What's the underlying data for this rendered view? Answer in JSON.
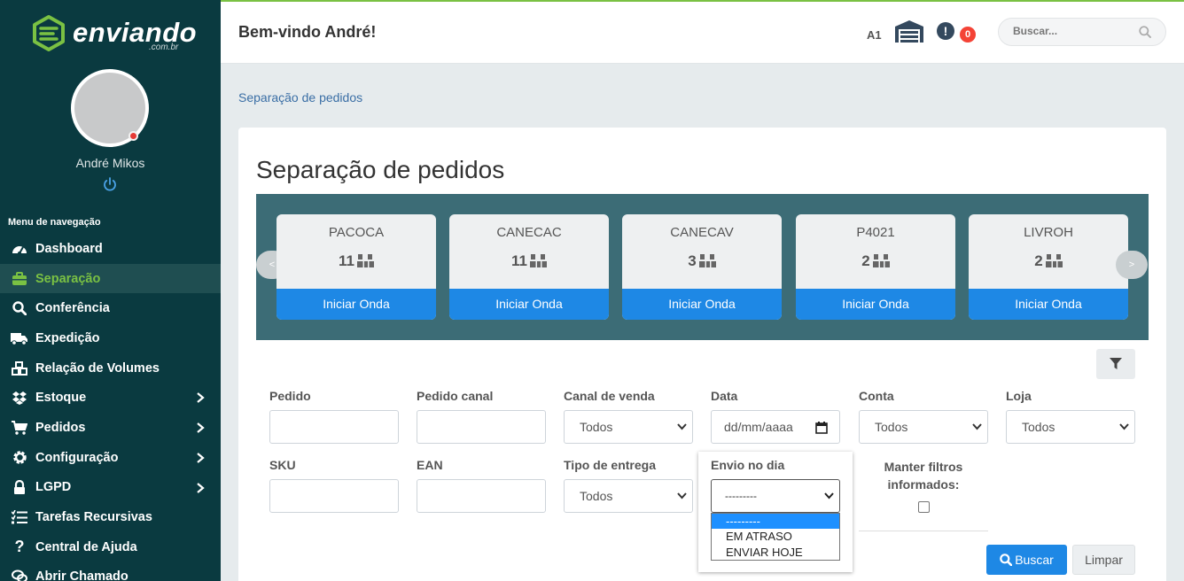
{
  "brand": {
    "name": "enviando",
    "tld": ".com.br",
    "color": "#7ac143"
  },
  "user": {
    "name": "André Mikos",
    "status_color": "#e53935"
  },
  "nav": {
    "header": "Menu de navegação",
    "items": [
      {
        "label": "Dashboard",
        "icon": "gauge-icon",
        "active": false,
        "submenu": false
      },
      {
        "label": "Separação",
        "icon": "briefcase-icon",
        "active": true,
        "submenu": false
      },
      {
        "label": "Conferência",
        "icon": "search-icon",
        "active": false,
        "submenu": false
      },
      {
        "label": "Expedição",
        "icon": "truck-icon",
        "active": false,
        "submenu": false
      },
      {
        "label": "Relação de Volumes",
        "icon": "cubes-icon",
        "active": false,
        "submenu": false
      },
      {
        "label": "Estoque",
        "icon": "dropbox-icon",
        "active": false,
        "submenu": true
      },
      {
        "label": "Pedidos",
        "icon": "cart-icon",
        "active": false,
        "submenu": true
      },
      {
        "label": "Configuração",
        "icon": "gear-icon",
        "active": false,
        "submenu": true
      },
      {
        "label": "LGPD",
        "icon": "lock-icon",
        "active": false,
        "submenu": true
      },
      {
        "label": "Tarefas Recursivas",
        "icon": "list-icon",
        "active": false,
        "submenu": false
      },
      {
        "label": "Central de Ajuda",
        "icon": "question-icon",
        "active": false,
        "submenu": false
      },
      {
        "label": "Abrir Chamado",
        "icon": "chat-icon",
        "active": false,
        "submenu": false
      }
    ]
  },
  "header": {
    "welcome": "Bem-vindo André!",
    "warehouse_code": "A1",
    "notifications": "0",
    "search_placeholder": "Buscar..."
  },
  "breadcrumb": "Separação de pedidos",
  "page_title": "Separação de pedidos",
  "waves": {
    "prev": "<",
    "next": ">",
    "items": [
      {
        "sku": "PACOCA",
        "count": "11",
        "action": "Iniciar Onda"
      },
      {
        "sku": "CANECAC",
        "count": "11",
        "action": "Iniciar Onda"
      },
      {
        "sku": "CANECAV",
        "count": "3",
        "action": "Iniciar Onda"
      },
      {
        "sku": "P4021",
        "count": "2",
        "action": "Iniciar Onda"
      },
      {
        "sku": "LIVROH",
        "count": "2",
        "action": "Iniciar Onda"
      }
    ]
  },
  "filters": {
    "pedido": {
      "label": "Pedido",
      "value": ""
    },
    "pedido_canal": {
      "label": "Pedido canal",
      "value": ""
    },
    "canal_venda": {
      "label": "Canal de venda",
      "value": "Todos"
    },
    "data": {
      "label": "Data",
      "placeholder": "dd/mm/aaaa"
    },
    "conta": {
      "label": "Conta",
      "value": "Todos"
    },
    "loja": {
      "label": "Loja",
      "value": "Todos"
    },
    "sku": {
      "label": "SKU",
      "value": ""
    },
    "ean": {
      "label": "EAN",
      "value": ""
    },
    "tipo_entrega": {
      "label": "Tipo de entrega",
      "value": "Todos"
    },
    "envio_dia": {
      "label": "Envio no dia",
      "value": "---------",
      "options": [
        "---------",
        "EM ATRASO",
        "ENVIAR HOJE"
      ]
    },
    "manter": {
      "label": "Manter filtros informados:",
      "checked": false
    }
  },
  "actions": {
    "search": "Buscar",
    "clear": "Limpar"
  },
  "colors": {
    "sidebar": "#0a3a40",
    "primary": "#1e88e5",
    "wave_panel": "#3c6c76",
    "badge": "#f44336"
  }
}
